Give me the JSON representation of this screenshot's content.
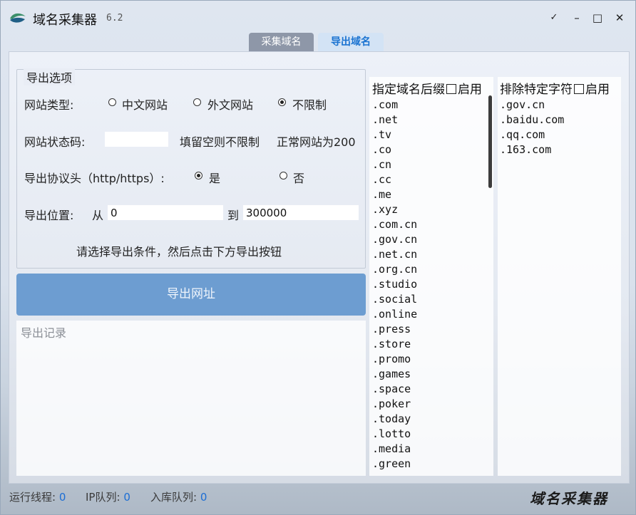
{
  "window": {
    "title": "域名采集器",
    "version": "6.2",
    "controls": {
      "pin": "✓",
      "minimize": "–",
      "maximize": "□",
      "close": "✕"
    }
  },
  "tabs": [
    {
      "label": "采集域名",
      "active": false
    },
    {
      "label": "导出域名",
      "active": true
    }
  ],
  "options": {
    "legend": "导出选项",
    "site_type": {
      "label": "网站类型:",
      "choices": [
        "中文网站",
        "外文网站",
        "不限制"
      ],
      "selected": "不限制"
    },
    "status_code": {
      "label": "网站状态码:",
      "value": "",
      "hint1": "填留空则不限制",
      "hint2": "正常网站为200"
    },
    "protocol": {
      "label": "导出协议头（http/https）:",
      "yes": "是",
      "no": "否",
      "selected": "是"
    },
    "position": {
      "label": "导出位置:",
      "from_label": "从",
      "from_value": "0",
      "to_label": "到",
      "to_value": "300000"
    },
    "instruction": "请选择导出条件，然后点击下方导出按钮"
  },
  "export_button": {
    "label": "导出网址"
  },
  "log": {
    "placeholder": "导出记录"
  },
  "suffix_panel": {
    "title": "指定域名后缀",
    "enable_label": "启用",
    "items": [
      ".com",
      ".net",
      ".tv",
      ".co",
      ".cn",
      ".cc",
      ".me",
      ".xyz",
      ".com.cn",
      ".gov.cn",
      ".net.cn",
      ".org.cn",
      ".studio",
      ".social",
      ".online",
      ".press",
      ".store",
      ".promo",
      ".games",
      ".space",
      ".poker",
      ".today",
      ".lotto",
      ".media",
      ".green"
    ]
  },
  "exclude_panel": {
    "title": "排除特定字符",
    "enable_label": "启用",
    "items": [
      ".gov.cn",
      ".baidu.com",
      ".qq.com",
      ".163.com"
    ]
  },
  "statusbar": {
    "threads_label": "运行线程:",
    "threads_value": "0",
    "ip_label": "IP队列:",
    "ip_value": "0",
    "db_label": "入库队列:",
    "db_value": "0",
    "brand": "域名采集器"
  },
  "colors": {
    "accent": "#1c6ed4",
    "button": "#6d9dd1",
    "inactive_tab": "#8e97a8"
  }
}
